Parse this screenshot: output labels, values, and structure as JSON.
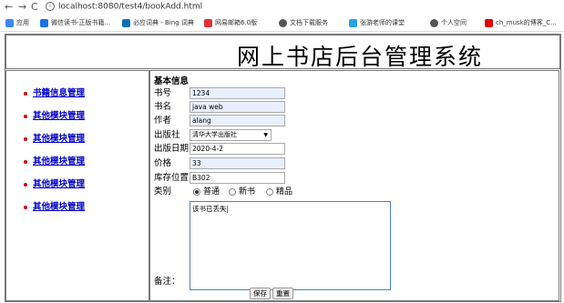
{
  "browser": {
    "url": "localhost:8080/test4/bookAdd.html",
    "bookmarks": [
      {
        "label": "应用",
        "color": "#4285f4"
      },
      {
        "label": "微信读书-正版书籍...",
        "color": "#1a73e8"
      },
      {
        "label": "必应词典 - Bing 词典",
        "color": "#0c6fb8"
      },
      {
        "label": "网易邮箱6.0版",
        "color": "#d33"
      },
      {
        "label": "文档下载服务",
        "color": "#555"
      },
      {
        "label": "张游老师的课堂",
        "color": "#2aa0e8"
      },
      {
        "label": "个人空间",
        "color": "#555"
      },
      {
        "label": "ch_musk的博客_C...",
        "color": "#d00"
      }
    ]
  },
  "page": {
    "title": "网上书店后台管理系统",
    "sidebar": [
      "书籍信息管理",
      "其他模块管理",
      "其他模块管理",
      "其他模块管理",
      "其他模块管理",
      "其他模块管理"
    ],
    "form": {
      "section_title": "基本信息",
      "labels": {
        "isbn": "书号",
        "name": "书名",
        "author": "作者",
        "publisher": "出版社",
        "date": "出版日期",
        "price": "价格",
        "location": "库存位置",
        "category": "类别",
        "remark": "备注："
      },
      "values": {
        "isbn": "1234",
        "name": "java web",
        "author": "alang",
        "publisher": "清华大学出版社",
        "date": "2020-4-2",
        "price": "33",
        "location": "B302",
        "remark": "该书已丢失|"
      },
      "categories": [
        "普通",
        "新书",
        "精品"
      ],
      "selected_category": "普通",
      "buttons": {
        "save": "保存",
        "reset": "重置"
      }
    }
  }
}
